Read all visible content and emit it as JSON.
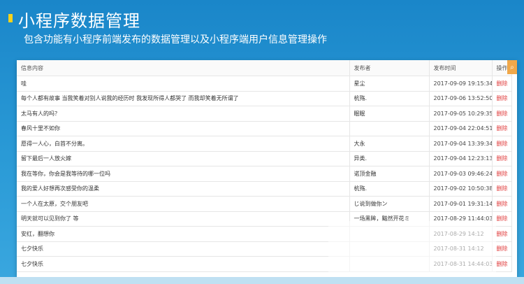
{
  "header": {
    "title": "小程序数据管理",
    "subtitle": "包含功能有小程序前端发布的数据管理以及小程序端用户信息管理操作"
  },
  "table": {
    "columns": [
      "信息内容",
      "发布者",
      "发布时间",
      "操作"
    ],
    "rows": [
      {
        "content": "哇",
        "publisher": "星尘",
        "time": "2017-09-09 19:15:34",
        "action": "删除"
      },
      {
        "content": "每个人都有故事 当我笑着对别人说我的经历时 我发现所得人都哭了 而我却笑着无所谓了",
        "publisher": "杭殇.",
        "time": "2017-09-06 13:52:50",
        "action": "删除"
      },
      {
        "content": "太马有人的吗？",
        "publisher": "眠眠",
        "time": "2017-09-05 10:29:35",
        "action": "删除"
      },
      {
        "content": "春风十里不如你",
        "publisher": "",
        "time": "2017-09-04 22:04:51",
        "action": "删除"
      },
      {
        "content": "愿得一人心，白首不分离。",
        "publisher": "大永",
        "time": "2017-09-04 13:39:34",
        "action": "删除"
      },
      {
        "content": "留下最后一人放火嫁",
        "publisher": "异类.",
        "time": "2017-09-04 12:23:13",
        "action": "删除"
      },
      {
        "content": "我在等你，你会是我等待的哪一位吗",
        "publisher": "诺顶金融",
        "time": "2017-09-03 09:46:24",
        "action": "删除"
      },
      {
        "content": "我的爱人好想再次感受你的温柔",
        "publisher": "杭殇.",
        "time": "2017-09-02 10:50:38",
        "action": "删除"
      },
      {
        "content": "一个人在太原，交个朋友吧",
        "publisher": "じ说到做你ン",
        "time": "2017-09-01 19:31:14",
        "action": "删除"
      },
      {
        "content": "明天就可以见到你了 等",
        "publisher": "一场黑眸，黯然开花ミ",
        "time": "2017-08-29 11:44:03",
        "action": "删除"
      },
      {
        "content": "安红，翻想你",
        "publisher": "",
        "time": "2017-08-29 14:12",
        "action": "删除"
      },
      {
        "content": "七夕快乐",
        "publisher": "",
        "time": "2017-08-31 14:12",
        "action": "删除"
      },
      {
        "content": "七夕快乐",
        "publisher": "",
        "time": "2017-08-31 14:44:03",
        "action": "删除"
      }
    ]
  },
  "colors": {
    "background": "#1a86c9",
    "accent_bullet": "#f6d21b",
    "action_link": "#e03a3a",
    "search_button": "#f0a84a"
  },
  "icons": {
    "search": "search-icon"
  }
}
